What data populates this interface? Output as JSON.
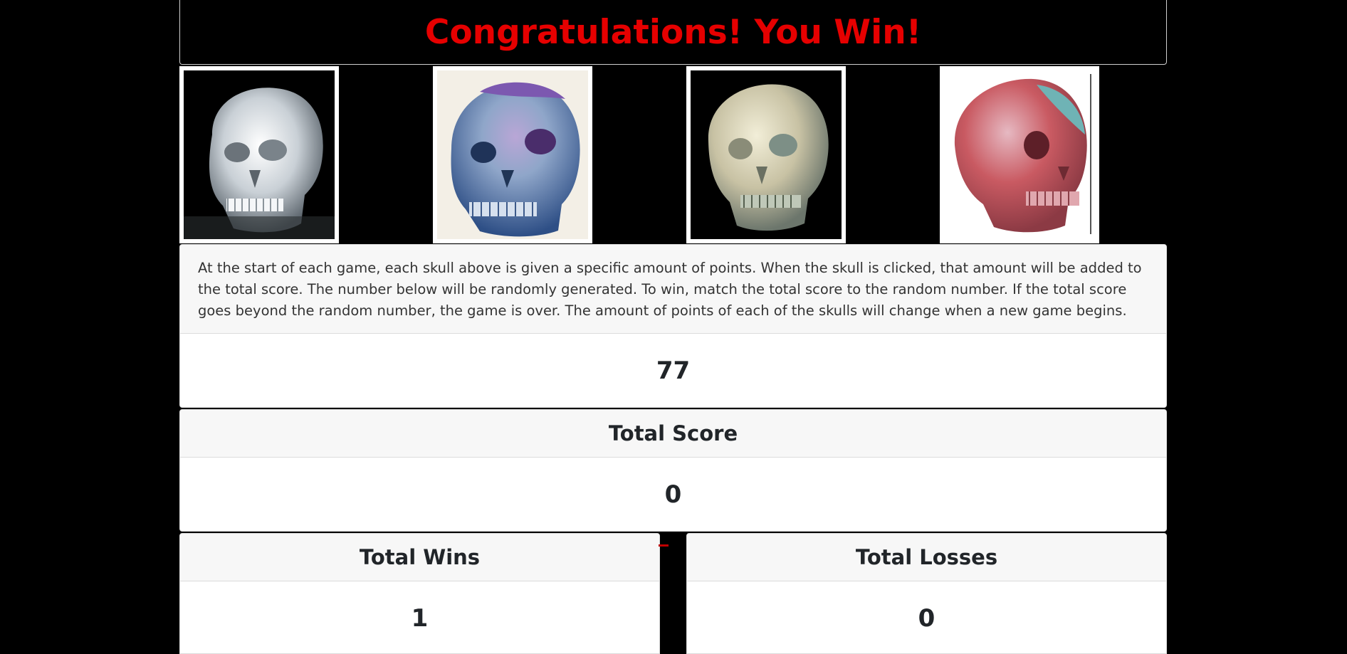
{
  "banner": {
    "message": "Congratulations! You Win!"
  },
  "skulls": [
    {
      "name": "clear-quartz-skull",
      "colors": [
        "#000000",
        "#e8ecef",
        "#9aa3ab"
      ]
    },
    {
      "name": "blue-agate-skull",
      "colors": [
        "#f3efe6",
        "#4a6fa8",
        "#7c58b0"
      ]
    },
    {
      "name": "smoky-quartz-skull",
      "colors": [
        "#000000",
        "#d9d3b8",
        "#7d8f86"
      ]
    },
    {
      "name": "red-jasper-skull",
      "colors": [
        "#ffffff",
        "#c95a62",
        "#6fb3b5"
      ]
    }
  ],
  "instructions": "At the start of each game, each skull above is given a specific amount of points. When the skull is clicked, that amount will be added to the total score. The number below will be randomly generated. To win, match the total score to the random number. If the total score goes beyond the random number, the game is over. The amount of points of each of the skulls will change when a new game begins.",
  "target_number": "77",
  "score": {
    "label": "Total Score",
    "value": "0"
  },
  "wins": {
    "label": "Total Wins",
    "value": "1"
  },
  "losses": {
    "label": "Total Losses",
    "value": "0"
  },
  "colors": {
    "accent": "#e60000",
    "background": "#000000",
    "card_header": "#f7f7f7"
  }
}
